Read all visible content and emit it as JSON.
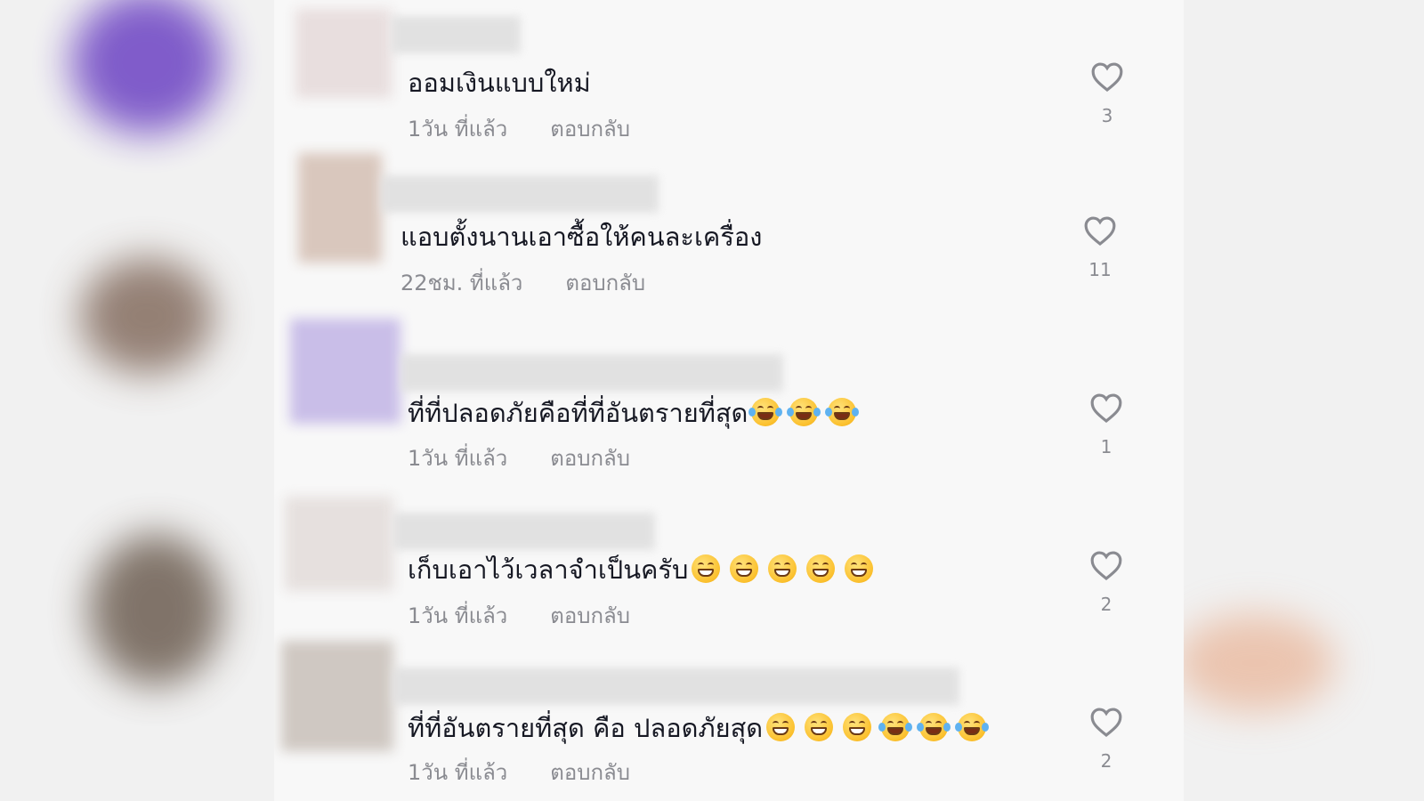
{
  "comments": [
    {
      "text": "ออมเงินแบบใหม่",
      "time": "1วัน ที่แล้ว",
      "reply": "ตอบกลับ",
      "likes": "3",
      "emojis": []
    },
    {
      "text": "แอบตั้งนานเอาซื้อให้คนละเครื่อง",
      "time": "22ชม. ที่แล้ว",
      "reply": "ตอบกลับ",
      "likes": "11",
      "emojis": []
    },
    {
      "text": "ที่ที่ปลอดภัยคือที่ที่อันตรายที่สุด",
      "time": "1วัน ที่แล้ว",
      "reply": "ตอบกลับ",
      "likes": "1",
      "emojis": [
        "joy",
        "joy",
        "joy"
      ]
    },
    {
      "text": "เก็บเอาไว้เวลาจำเป็นครับ",
      "time": "1วัน ที่แล้ว",
      "reply": "ตอบกลับ",
      "likes": "2",
      "emojis": [
        "grin",
        "grin",
        "grin",
        "grin",
        "grin"
      ]
    },
    {
      "text": "ที่ที่อันตรายที่สุด คือ ปลอดภัยสุด",
      "time": "1วัน ที่แล้ว",
      "reply": "ตอบกลับ",
      "likes": "2",
      "emojis": [
        "grin",
        "grin",
        "grin",
        "joy",
        "joy",
        "joy"
      ]
    }
  ],
  "icons": {
    "like": "heart-outline-icon",
    "emoji_joy": "face-with-tears-of-joy-icon",
    "emoji_grin": "grinning-face-icon"
  },
  "colors": {
    "text": "#161823",
    "muted": "#8a8b91",
    "heart": "#8a8b91"
  }
}
